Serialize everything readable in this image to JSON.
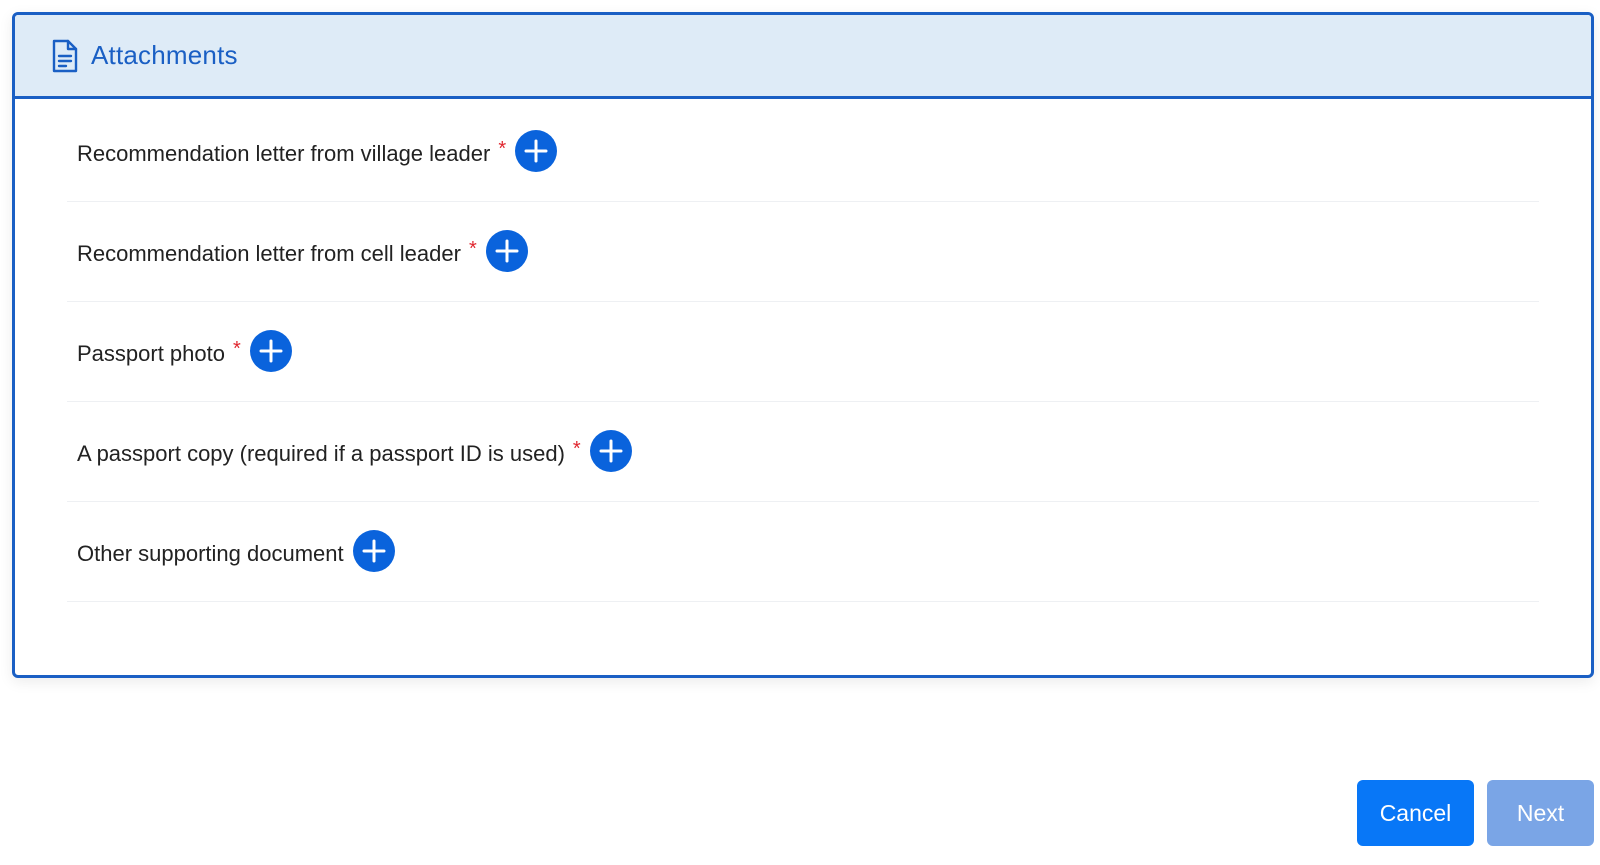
{
  "card": {
    "title": "Attachments",
    "icon": "document-icon"
  },
  "attachments": [
    {
      "label": "Recommendation letter from village leader",
      "required": true,
      "required_mark": "*"
    },
    {
      "label": "Recommendation letter from cell leader",
      "required": true,
      "required_mark": "*"
    },
    {
      "label": "Passport photo",
      "required": true,
      "required_mark": "*"
    },
    {
      "label": "A passport copy (required if a passport ID is used)",
      "required": true,
      "required_mark": "*"
    },
    {
      "label": "Other supporting document",
      "required": false,
      "required_mark": ""
    }
  ],
  "footer": {
    "cancel_label": "Cancel",
    "next_label": "Next"
  },
  "colors": {
    "accent": "#1a5fc4",
    "header_bg": "#deebf7",
    "add_button": "#0a63dc",
    "required": "#e0262f",
    "cancel_button": "#0877f7",
    "next_button_disabled": "#7aa5e6"
  }
}
